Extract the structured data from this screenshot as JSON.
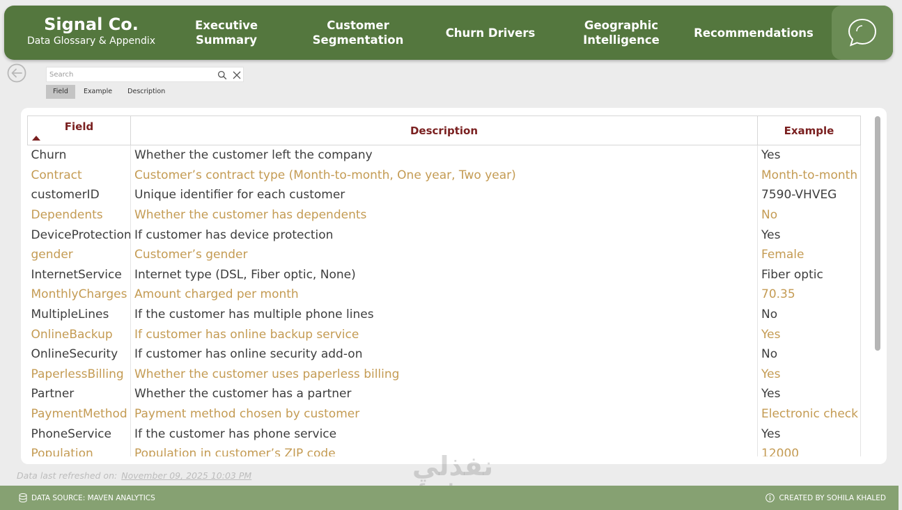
{
  "header": {
    "brand_title": "Signal Co.",
    "brand_subtitle": "Data Glossary & Appendix",
    "nav": [
      {
        "label": "Executive Summary"
      },
      {
        "label": "Customer Segmentation"
      },
      {
        "label": "Churn Drivers"
      },
      {
        "label": "Geographic Intelligence"
      },
      {
        "label": "Recommendations"
      }
    ],
    "chat_icon": "chat-bubble-icon",
    "accent_color": "#54773e"
  },
  "search": {
    "placeholder": "Search",
    "value": ""
  },
  "filters": [
    {
      "label": "Field",
      "active": true
    },
    {
      "label": "Example",
      "active": false
    },
    {
      "label": "Description",
      "active": false
    }
  ],
  "table": {
    "headers": {
      "field": "Field",
      "description": "Description",
      "example": "Example"
    },
    "sort": "ascending",
    "rows": [
      {
        "field": "Churn",
        "description": "Whether the customer left the company",
        "example": "Yes"
      },
      {
        "field": "Contract",
        "description": "Customer’s contract type (Month-to-month, One year, Two year)",
        "example": "Month-to-month"
      },
      {
        "field": "customerID",
        "description": "Unique identifier for each customer",
        "example": "7590-VHVEG"
      },
      {
        "field": "Dependents",
        "description": "Whether the customer has dependents",
        "example": "No"
      },
      {
        "field": "DeviceProtection",
        "description": "If customer has device protection",
        "example": "Yes"
      },
      {
        "field": "gender",
        "description": "Customer’s gender",
        "example": "Female"
      },
      {
        "field": "InternetService",
        "description": "Internet type (DSL, Fiber optic, None)",
        "example": "Fiber optic"
      },
      {
        "field": "MonthlyCharges",
        "description": "Amount charged per month",
        "example": "70.35"
      },
      {
        "field": "MultipleLines",
        "description": "If the customer has multiple phone lines",
        "example": "No"
      },
      {
        "field": "OnlineBackup",
        "description": "If customer has online backup service",
        "example": "Yes"
      },
      {
        "field": "OnlineSecurity",
        "description": "If customer has online security add-on",
        "example": "No"
      },
      {
        "field": "PaperlessBilling",
        "description": "Whether the customer uses paperless billing",
        "example": "Yes"
      },
      {
        "field": "Partner",
        "description": "Whether the customer has a partner",
        "example": "Yes"
      },
      {
        "field": "PaymentMethod",
        "description": "Payment method chosen by customer",
        "example": "Electronic check"
      },
      {
        "field": "PhoneService",
        "description": "If the customer has phone service",
        "example": "Yes"
      },
      {
        "field": "Population",
        "description": "Population in customer’s ZIP code",
        "example": "12000"
      }
    ]
  },
  "footer": {
    "refresh_label": "Data last refreshed on:",
    "refresh_date": "November 09, 2025 10:03 PM",
    "data_source": "DATA SOURCE: MAVEN ANALYTICS",
    "created_by": "CREATED BY SOHILA KHALED"
  },
  "watermark": {
    "arabic": "نفذلي",
    "latin": "nafezly.com"
  }
}
